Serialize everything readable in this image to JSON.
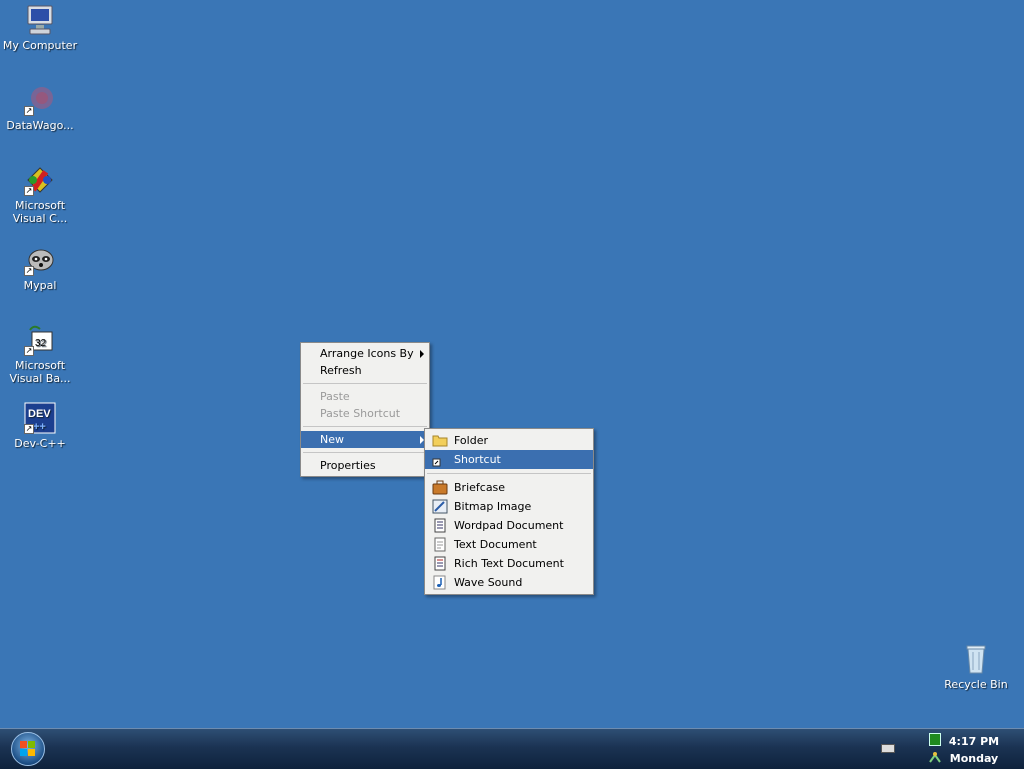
{
  "desktop": {
    "icons": [
      {
        "label": "My Computer"
      },
      {
        "label": "DataWago..."
      },
      {
        "label": "Microsoft Visual C..."
      },
      {
        "label": "Mypal"
      },
      {
        "label": "Microsoft Visual Ba..."
      },
      {
        "label": "Dev-C++"
      },
      {
        "label": "Recycle Bin"
      }
    ],
    "background_color": "#3a76b6"
  },
  "context_menu": {
    "items": [
      {
        "label": "Arrange Icons By",
        "submenu": true
      },
      {
        "label": "Refresh"
      },
      {
        "label": "Paste",
        "disabled": true
      },
      {
        "label": "Paste Shortcut",
        "disabled": true
      },
      {
        "label": "New",
        "submenu": true,
        "selected": true
      },
      {
        "label": "Properties"
      }
    ]
  },
  "new_submenu": {
    "items": [
      {
        "label": "Folder",
        "icon": "folder-icon"
      },
      {
        "label": "Shortcut",
        "icon": "shortcut-icon",
        "selected": true
      },
      {
        "label": "Briefcase",
        "icon": "briefcase-icon"
      },
      {
        "label": "Bitmap Image",
        "icon": "bitmap-icon"
      },
      {
        "label": "Wordpad Document",
        "icon": "wordpad-icon"
      },
      {
        "label": "Text Document",
        "icon": "text-document-icon"
      },
      {
        "label": "Rich Text Document",
        "icon": "rich-text-icon"
      },
      {
        "label": "Wave Sound",
        "icon": "wave-sound-icon"
      }
    ]
  },
  "taskbar": {
    "time": "4:17 PM",
    "day": "Monday"
  },
  "colors": {
    "selection": "#3b6fb0",
    "menu_background": "#f1f1ef"
  }
}
